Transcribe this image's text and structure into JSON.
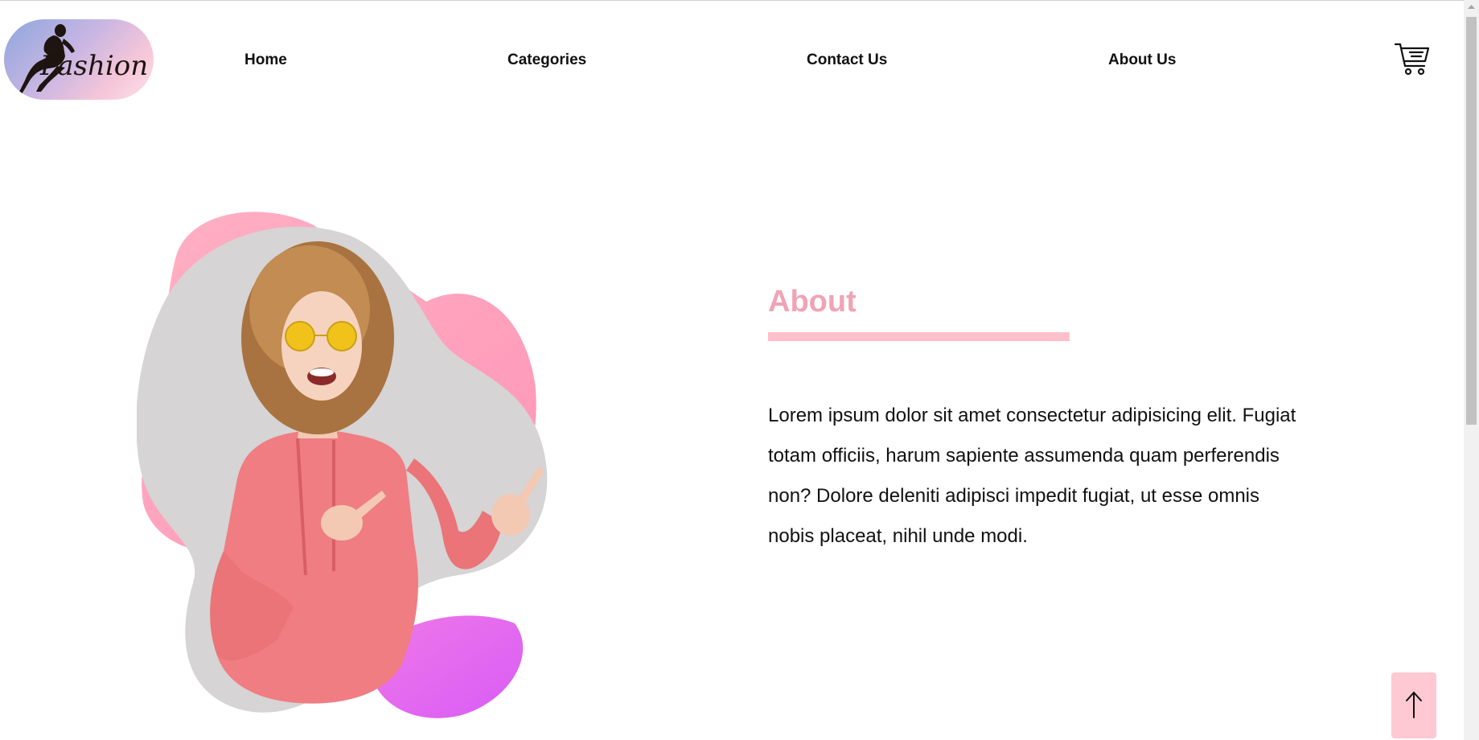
{
  "brand": {
    "logo_text": "Fashion"
  },
  "nav": {
    "items": [
      {
        "label": "Home"
      },
      {
        "label": "Categories"
      },
      {
        "label": "Contact Us"
      },
      {
        "label": "About Us"
      }
    ],
    "cart_icon": "shopping-cart-icon"
  },
  "about": {
    "title": "About",
    "body": "Lorem ipsum dolor sit amet consectetur adipisicing elit. Fugiat totam officiis, harum sapiente assumenda quam perferendis non? Dolore deleniti adipisci impedit fugiat, ut esse omnis nobis placeat, nihil unde modi."
  },
  "scroll_top": {
    "icon": "arrow-up-icon"
  },
  "colors": {
    "accent_pink": "#ffc0cb",
    "title_pink": "#f1a3b6",
    "blob_pink": "#ff9fba",
    "blob_violet": "#e566f5",
    "photo_bg": "#d6d4d4"
  }
}
